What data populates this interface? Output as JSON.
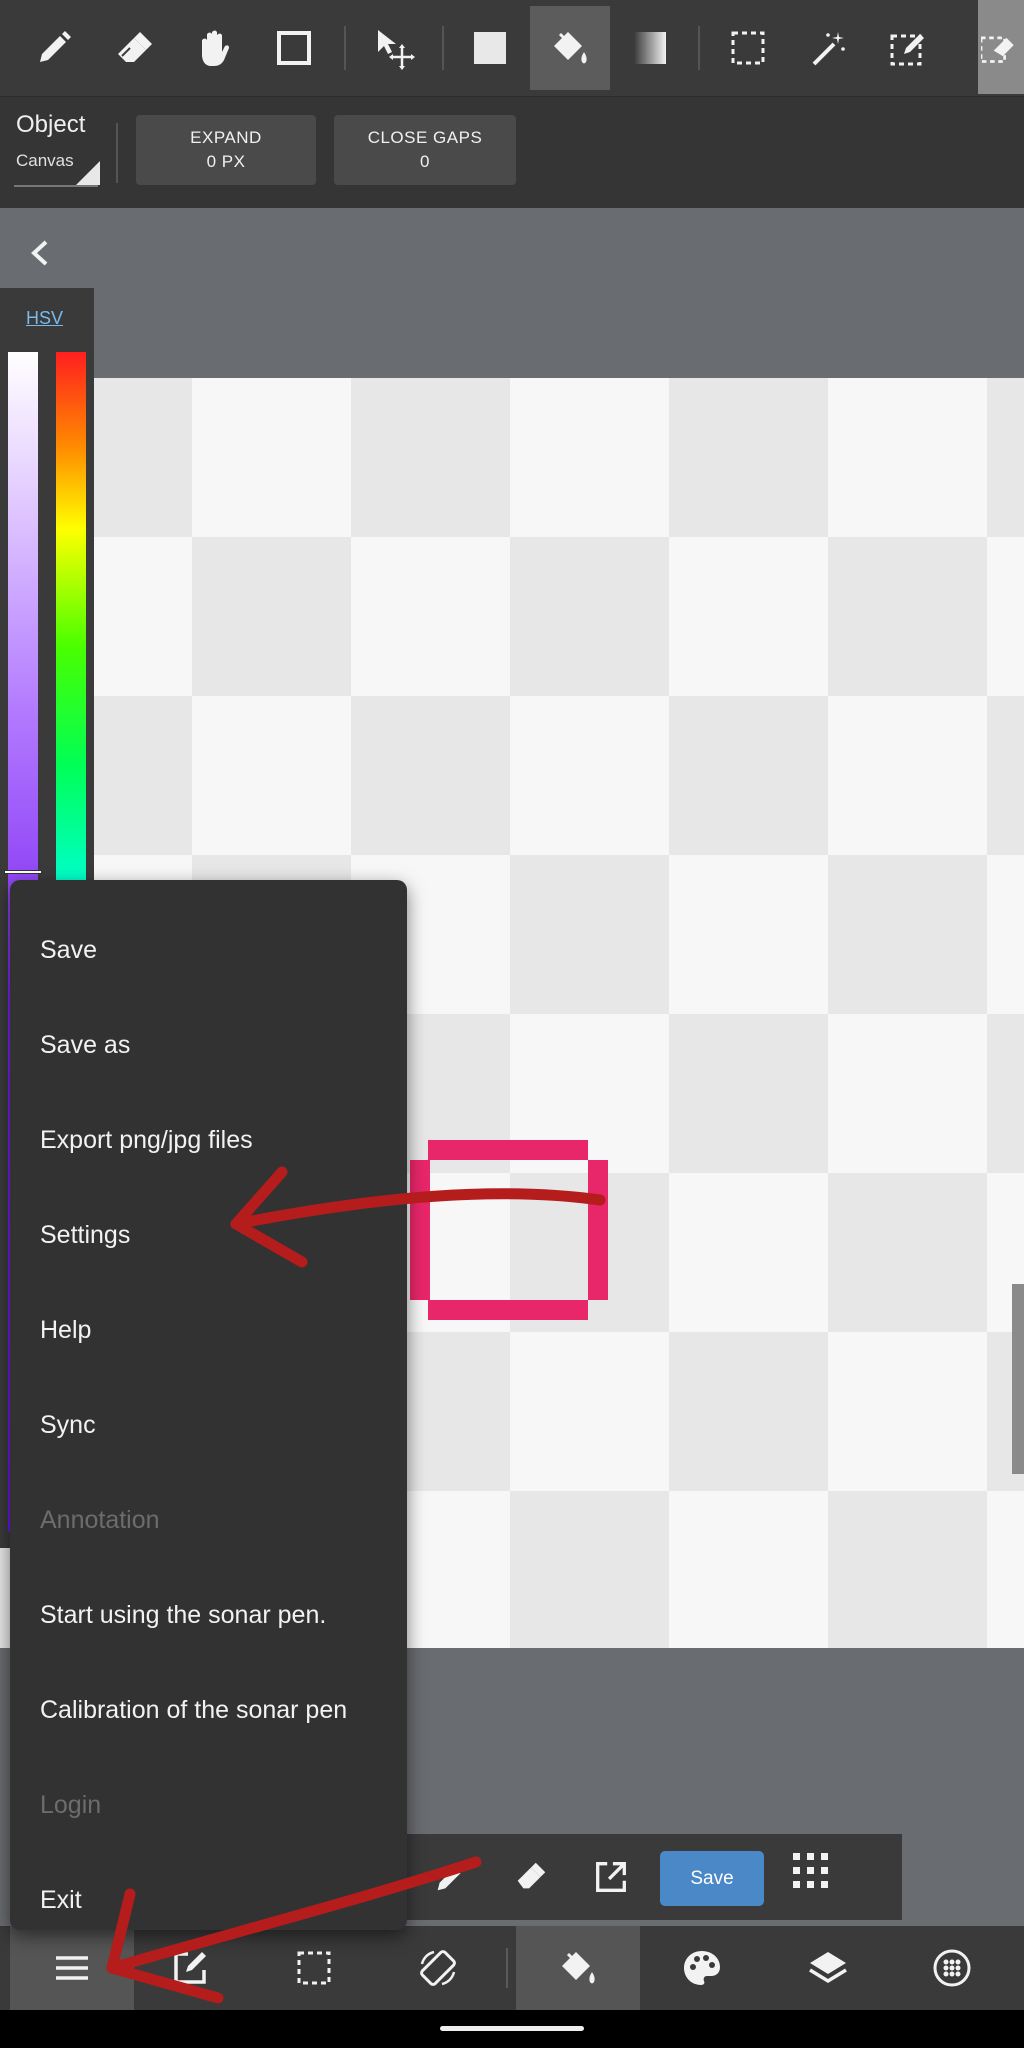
{
  "toolbar": {
    "tools": [
      "pen-icon",
      "eraser-icon",
      "hand-icon",
      "rectangle-icon",
      "move-icon",
      "fill-color-icon",
      "bucket-icon",
      "gradient-icon",
      "select-rect-icon",
      "magic-wand-icon",
      "select-pen-icon",
      "select-eraser-icon"
    ],
    "active_tool": "bucket-icon"
  },
  "options": {
    "object_label": "Object",
    "object_value": "Canvas",
    "expand_label": "EXPAND",
    "expand_value": "0 PX",
    "close_gaps_label": "CLOSE GAPS",
    "close_gaps_value": "0"
  },
  "color_panel": {
    "mode_tab": "HSV"
  },
  "menu": {
    "items": [
      {
        "label": "Save",
        "enabled": true
      },
      {
        "label": "Save as",
        "enabled": true
      },
      {
        "label": "Export png/jpg files",
        "enabled": true
      },
      {
        "label": "Settings",
        "enabled": true
      },
      {
        "label": "Help",
        "enabled": true
      },
      {
        "label": "Sync",
        "enabled": true
      },
      {
        "label": "Annotation",
        "enabled": false
      },
      {
        "label": "Start using the sonar pen.",
        "enabled": true
      },
      {
        "label": "Calibration of the sonar pen",
        "enabled": true
      },
      {
        "label": "Login",
        "enabled": false
      },
      {
        "label": "Exit",
        "enabled": true
      }
    ]
  },
  "mini_toolbar": {
    "save_label": "Save"
  },
  "bottom_nav": {
    "items": [
      "menu-icon",
      "edit-icon",
      "selection-icon",
      "rotate-icon",
      "bucket-icon",
      "palette-icon",
      "layers-icon",
      "materials-icon"
    ],
    "active": "bucket-icon"
  },
  "colors": {
    "accent": "#4a88c7",
    "shape": "#e8266a",
    "annotation": "#b51c1c"
  }
}
